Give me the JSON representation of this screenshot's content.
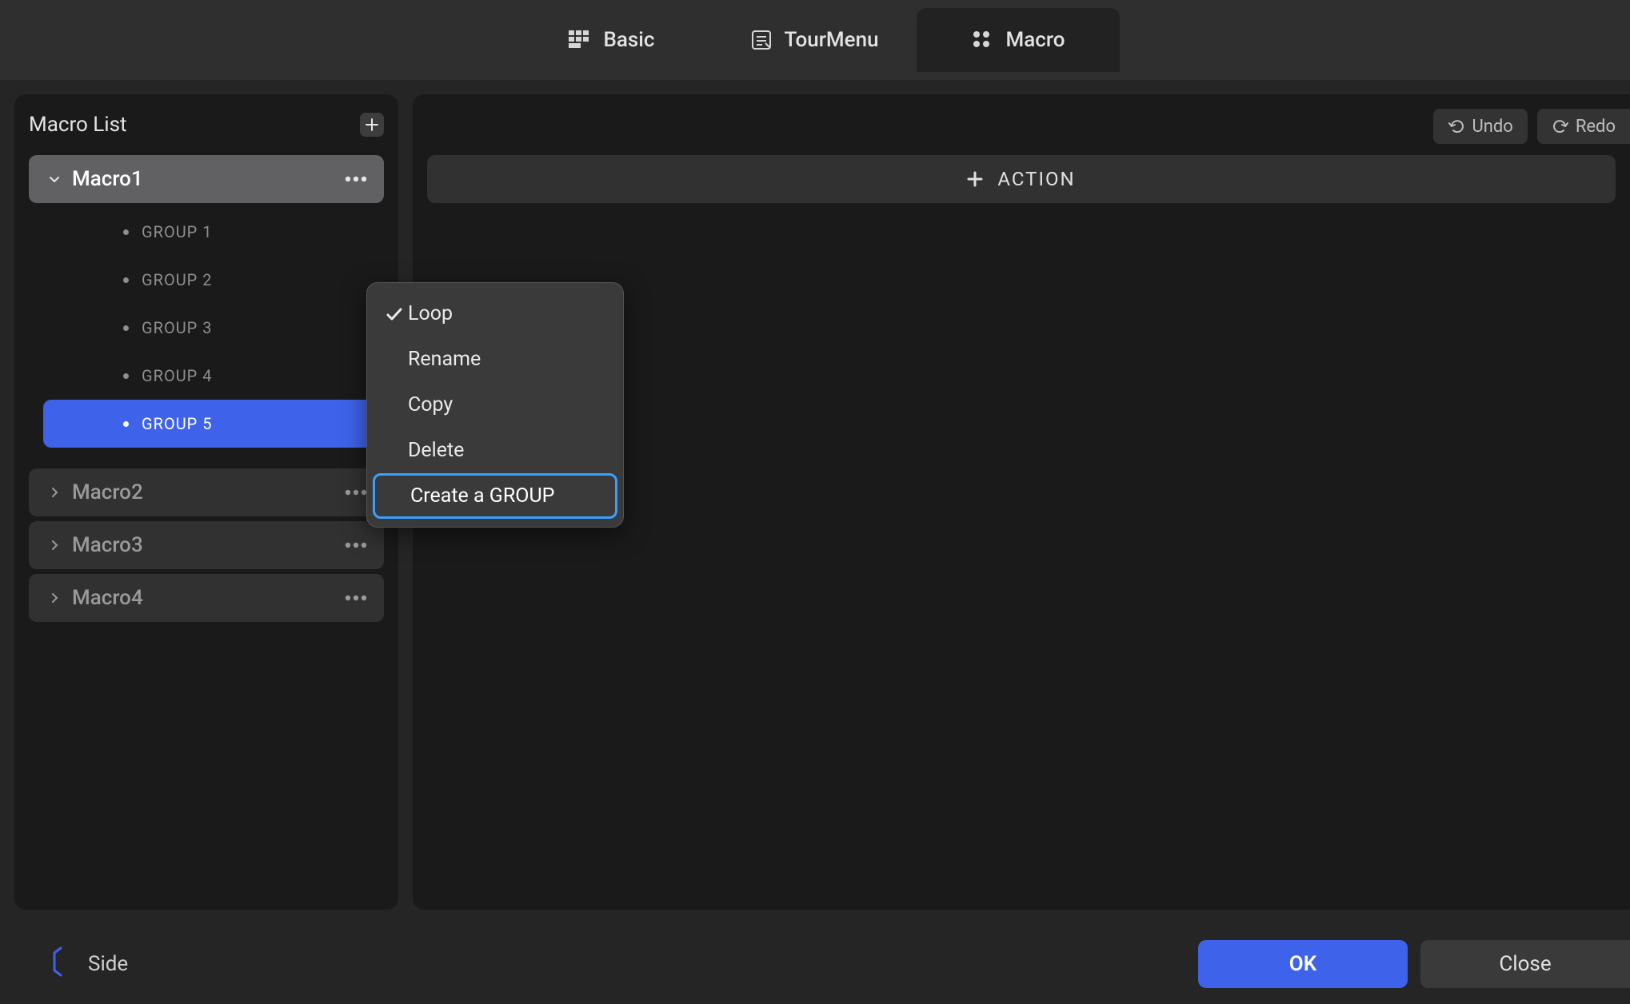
{
  "tabs": {
    "basic": "Basic",
    "tourmenu": "TourMenu",
    "macro": "Macro",
    "active": "macro"
  },
  "sidebar": {
    "title": "Macro List",
    "macros": [
      {
        "label": "Macro1",
        "expanded": true,
        "groups": [
          "GROUP 1",
          "GROUP 2",
          "GROUP 3",
          "GROUP 4",
          "GROUP 5"
        ],
        "activeGroup": 4
      },
      {
        "label": "Macro2",
        "expanded": false
      },
      {
        "label": "Macro3",
        "expanded": false
      },
      {
        "label": "Macro4",
        "expanded": false
      }
    ]
  },
  "toolbar": {
    "undo": "Undo",
    "redo": "Redo",
    "action": "ACTION"
  },
  "context_menu": {
    "items": [
      {
        "label": "Loop",
        "checked": true
      },
      {
        "label": "Rename"
      },
      {
        "label": "Copy"
      },
      {
        "label": "Delete"
      },
      {
        "label": "Create a GROUP",
        "highlight": true
      }
    ]
  },
  "bottom": {
    "side": "Side",
    "ok": "OK",
    "close": "Close"
  }
}
